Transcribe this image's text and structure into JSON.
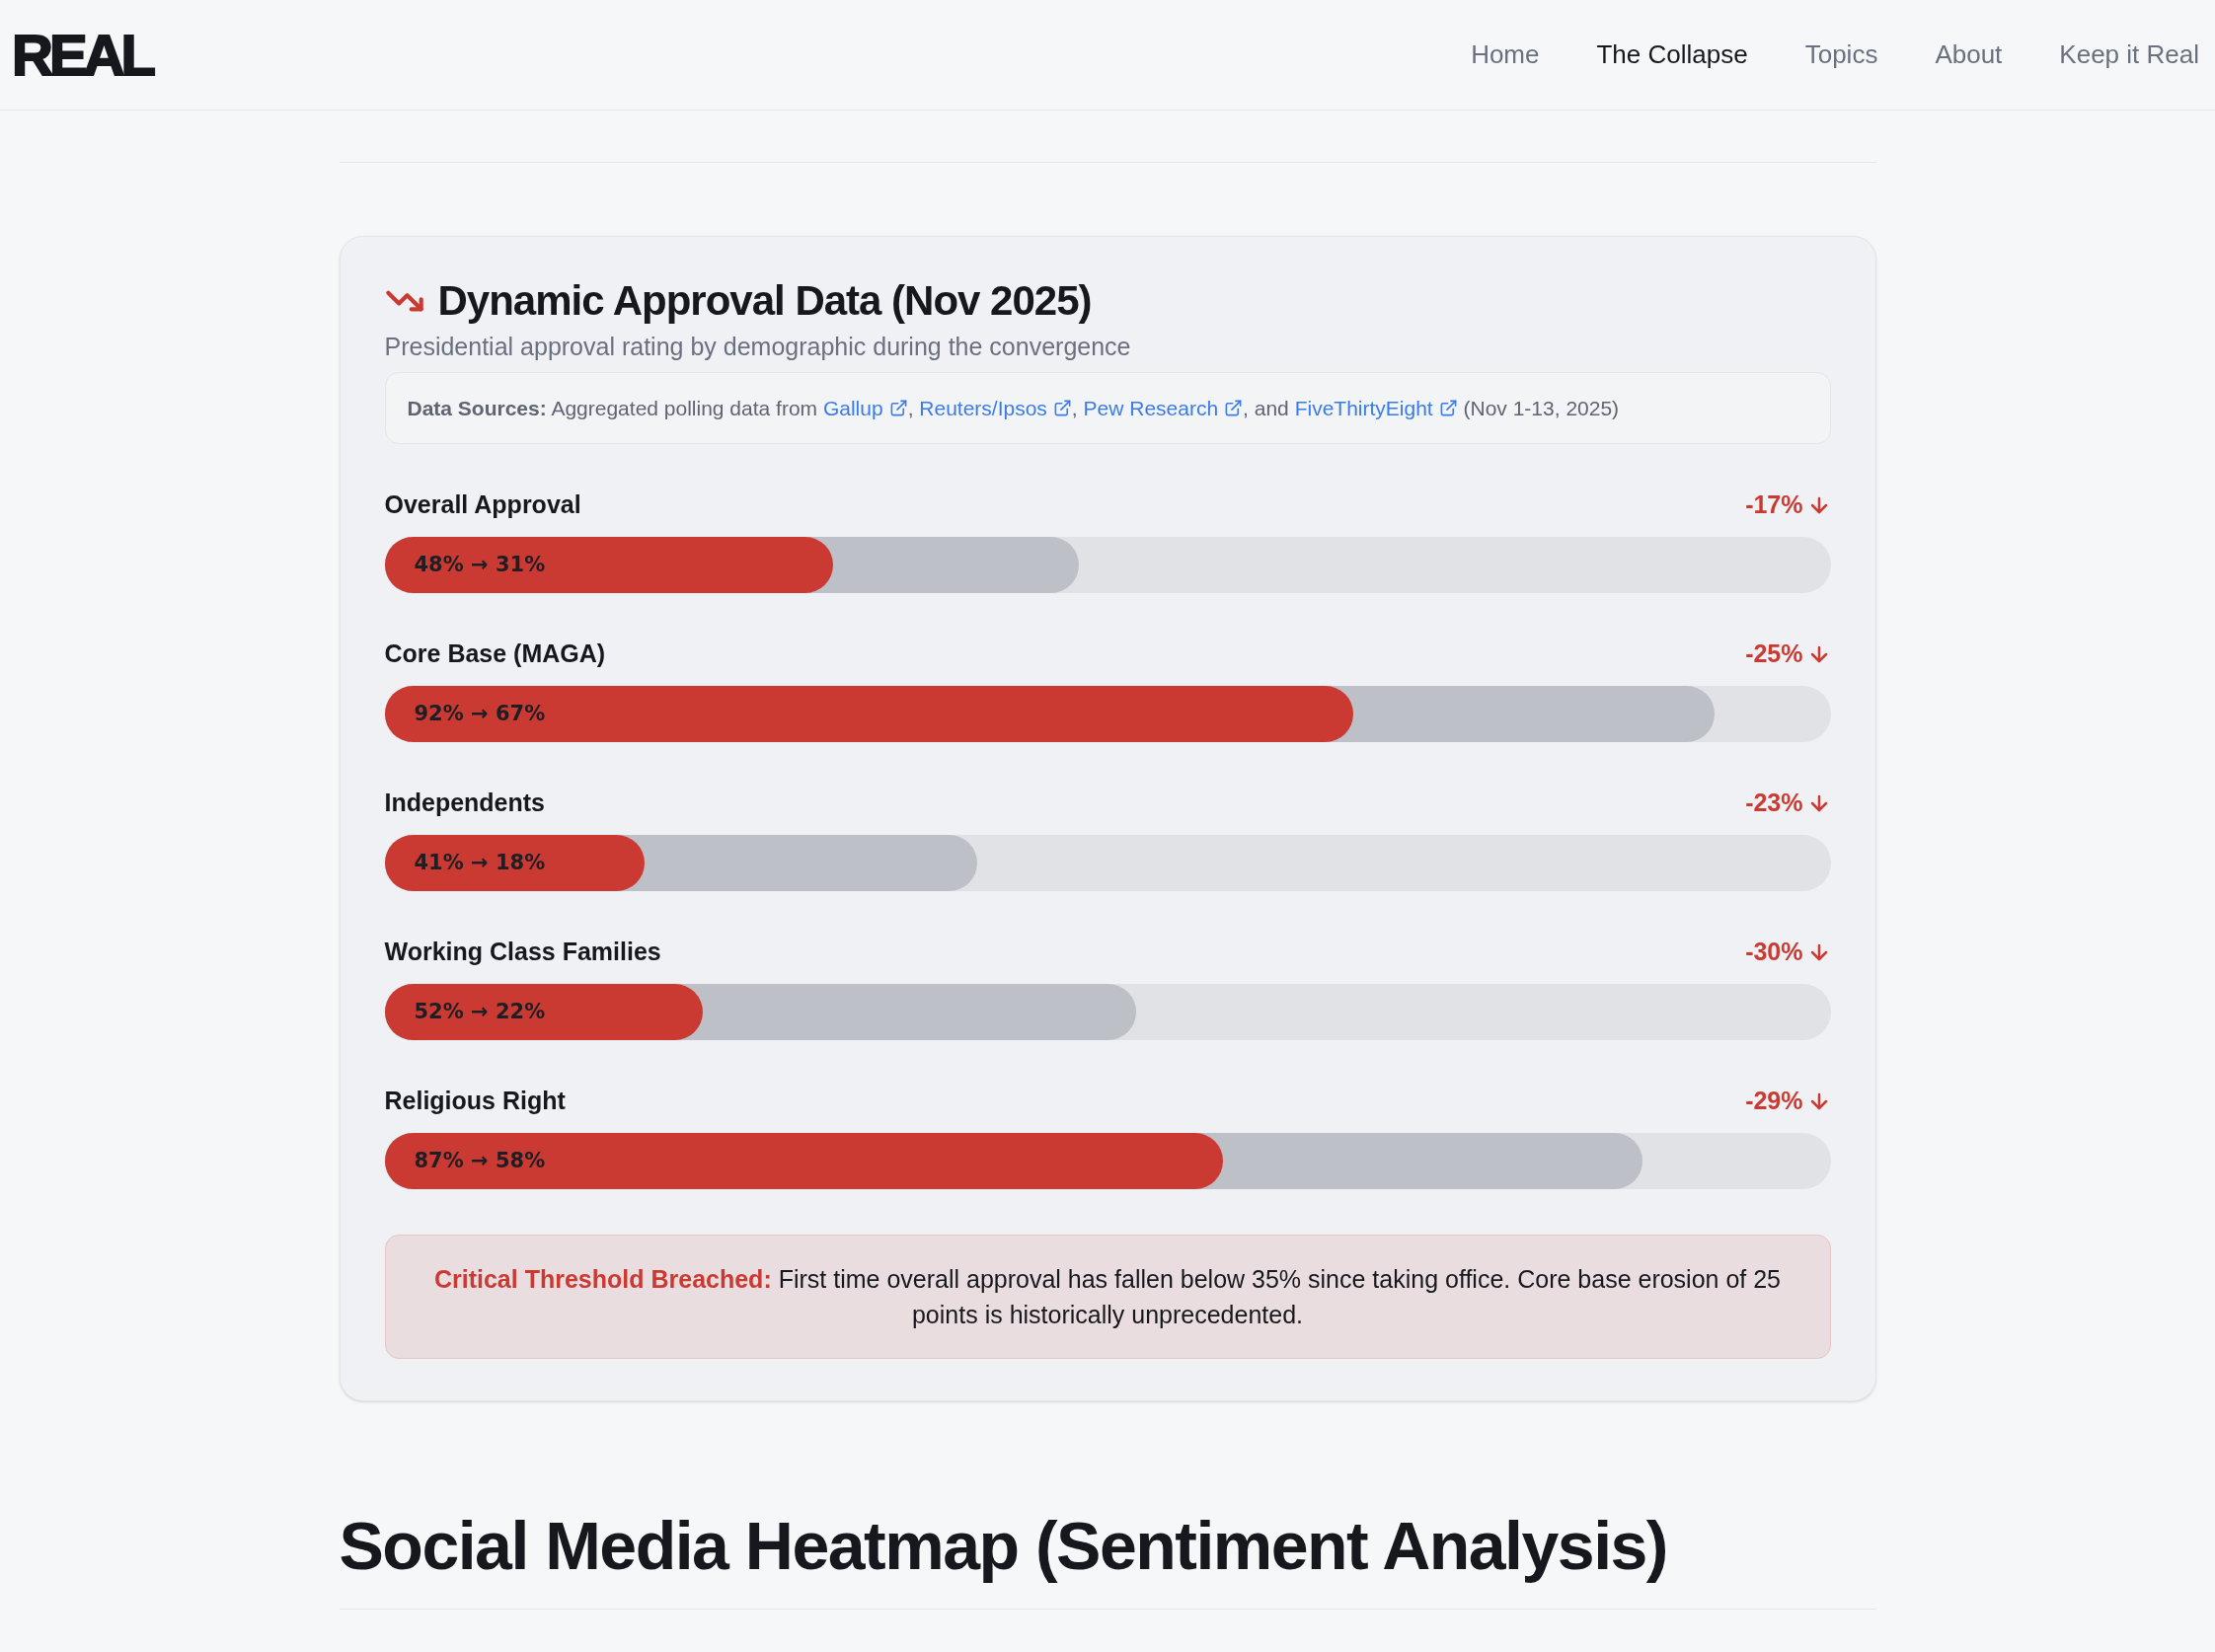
{
  "header": {
    "logo": "REAL",
    "nav": [
      {
        "label": "Home",
        "selected": false
      },
      {
        "label": "The Collapse",
        "selected": true
      },
      {
        "label": "Topics",
        "selected": false
      },
      {
        "label": "About",
        "selected": false
      },
      {
        "label": "Keep it Real",
        "selected": false
      }
    ]
  },
  "card": {
    "title": "Dynamic Approval Data (Nov 2025)",
    "subtitle": "Presidential approval rating by demographic during the convergence",
    "sources": [
      {
        "kind": "text",
        "text": "**Data Sources:** Aggregated polling data from "
      },
      {
        "kind": "link",
        "text": "Gallup"
      },
      {
        "kind": "text",
        "text": ", "
      },
      {
        "kind": "link",
        "text": "Reuters/Ipsos"
      },
      {
        "kind": "text",
        "text": ", "
      },
      {
        "kind": "link",
        "text": "Pew Research"
      },
      {
        "kind": "text",
        "text": ", and "
      },
      {
        "kind": "link",
        "text": "FiveThirtyEight"
      },
      {
        "kind": "text",
        "text": " (Nov 1-13, 2025)"
      }
    ],
    "rows": [
      {
        "label": "Overall Approval",
        "change": "-17%",
        "values": "48% → 31%",
        "before": {
          "level": 0.48
        },
        "after": {
          "level": 0.31
        }
      },
      {
        "label": "Core Base (MAGA)",
        "change": "-25%",
        "values": "92% → 67%",
        "before": {
          "level": 0.92
        },
        "after": {
          "level": 0.67
        }
      },
      {
        "label": "Independents",
        "change": "-23%",
        "values": "41% → 18%",
        "before": {
          "level": 0.41
        },
        "after": {
          "level": 0.18
        }
      },
      {
        "label": "Working Class Families",
        "change": "-30%",
        "values": "52% → 22%",
        "before": {
          "level": 0.52
        },
        "after": {
          "level": 0.22
        }
      },
      {
        "label": "Religious Right",
        "change": "-29%",
        "values": "87% → 58%",
        "before": {
          "level": 0.87
        },
        "after": {
          "level": 0.58
        }
      }
    ],
    "alert": "**Critical Threshold Breached:** First time overall approval has fallen below 35% since taking office. Core base erosion of 25 points is historically unprecedented."
  },
  "next_section_title": "Social Media Heatmap (Sentiment Analysis)"
}
